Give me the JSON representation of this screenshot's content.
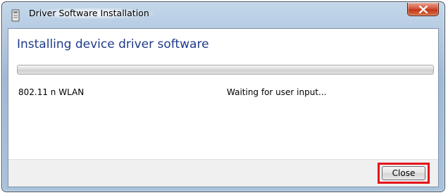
{
  "window": {
    "title": "Driver Software Installation",
    "icons": {
      "app": "installer-icon",
      "close": "close-icon"
    }
  },
  "content": {
    "heading": "Installing device driver software",
    "progress": {
      "value": 0
    },
    "device": {
      "name": "802.11 n WLAN",
      "status": "Waiting for user input..."
    }
  },
  "footer": {
    "close_label": "Close"
  },
  "colors": {
    "heading": "#1e3a8a",
    "highlight": "#e4151b",
    "close_x": "#c7401f"
  }
}
